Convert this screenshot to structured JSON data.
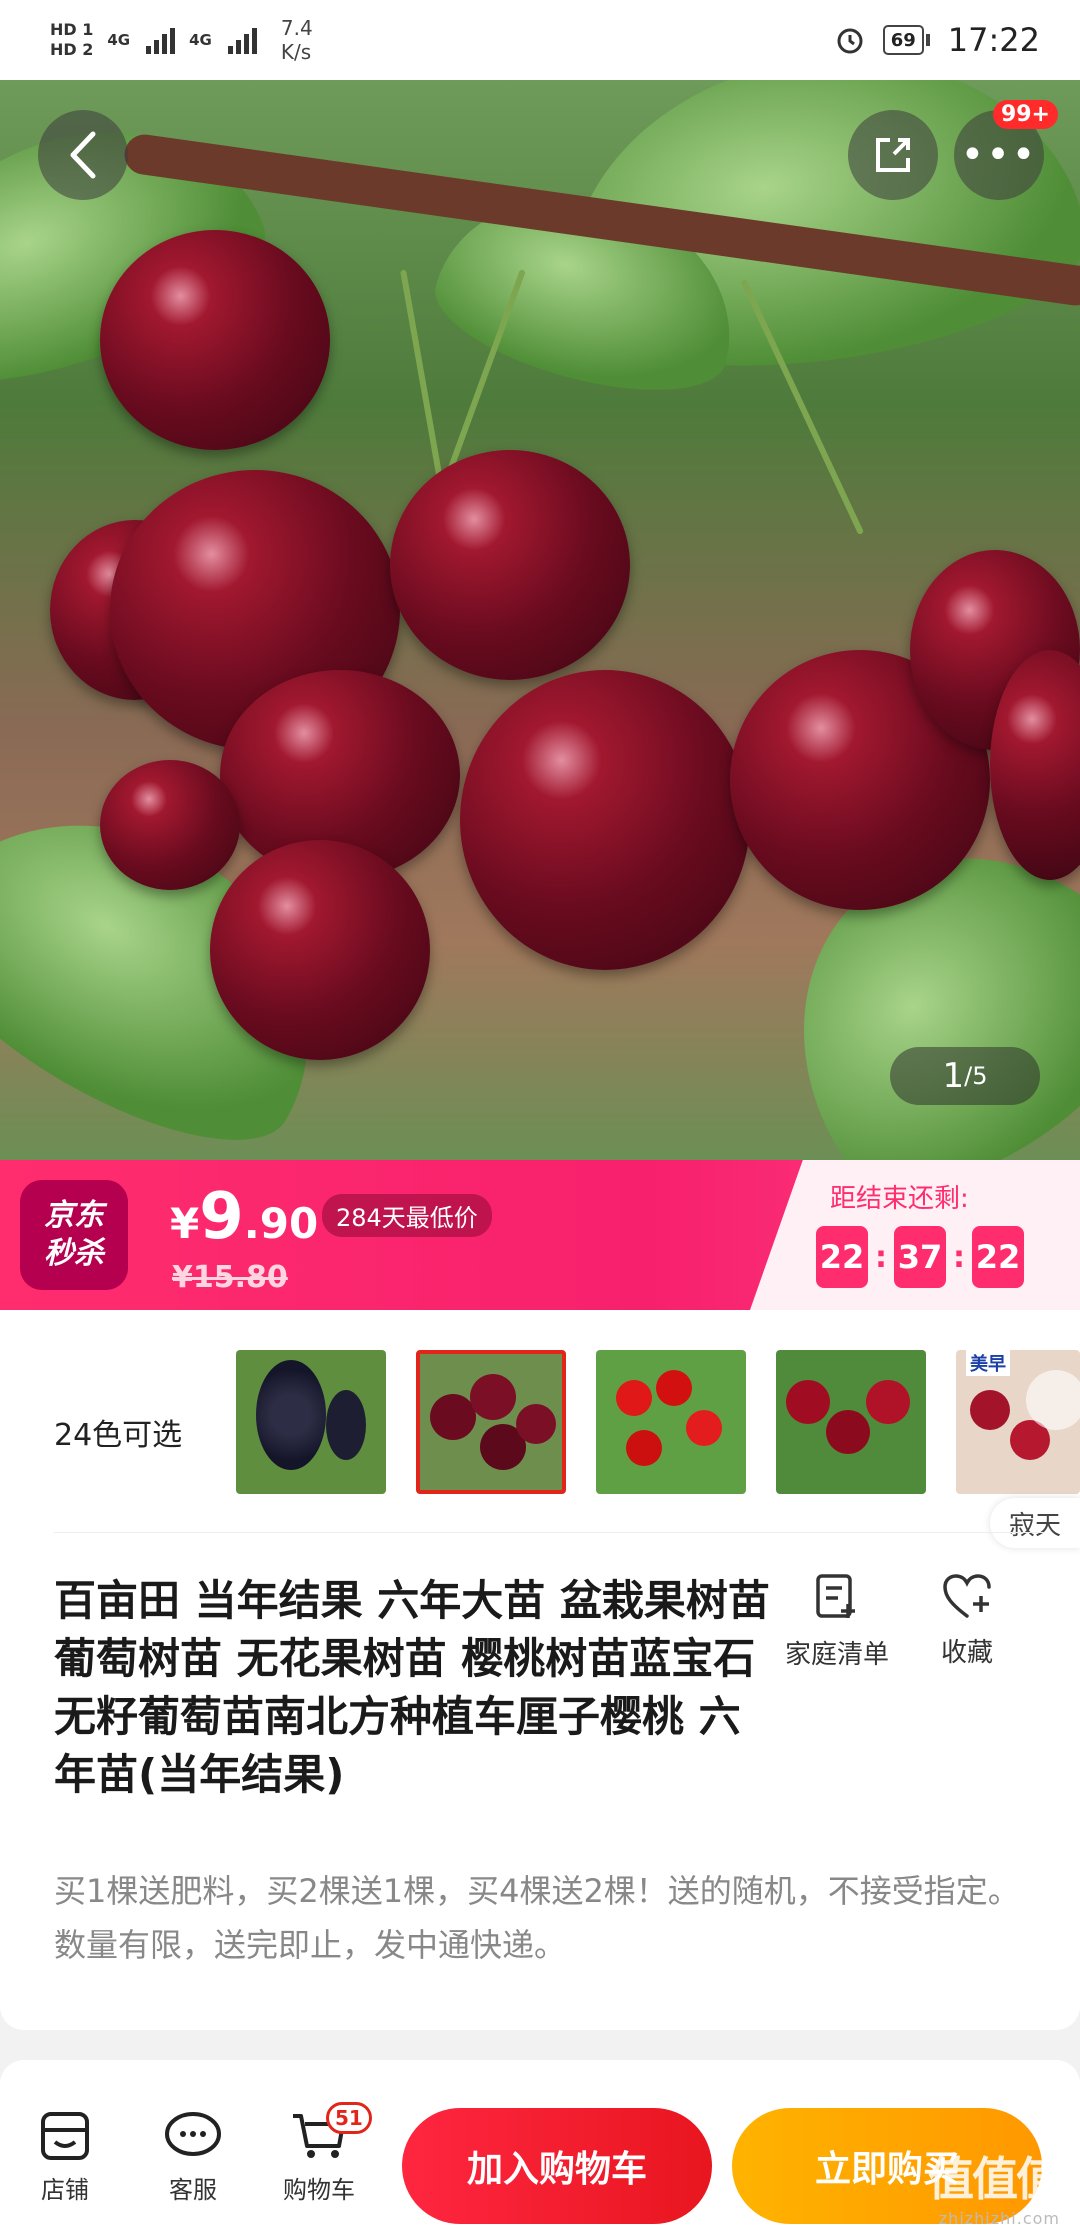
{
  "status_bar": {
    "sim1": "HD 1",
    "sim2": "HD 2",
    "net1": "4G",
    "net2": "4G",
    "speed": "7.4\nK/s",
    "battery": "69",
    "time": "17:22"
  },
  "hero": {
    "more_badge": "99+",
    "pager_current": "1",
    "pager_total": "/5"
  },
  "flash_sale": {
    "logo_line1": "京东",
    "logo_line2": "秒杀",
    "price_symbol": "¥",
    "price_int": "9",
    "price_dec": ".90",
    "lowest_tag": "284天最低价",
    "original_price": "¥15.80",
    "countdown_label": "距结束还剩:",
    "hours": "22",
    "minutes": "37",
    "seconds": "22",
    "colors": {
      "primary": "#ff2d6e",
      "light_bg": "#fff0f5"
    }
  },
  "variants": {
    "label": "24色可选",
    "thumb5_label": "美早",
    "side_tag": "寂天"
  },
  "product": {
    "title": "百亩田 当年结果 六年大苗 盆栽果树苗 葡萄树苗 无花果树苗 樱桃树苗蓝宝石无籽葡萄苗南北方种植车厘子樱桃 六年苗(当年结果)",
    "family_list_label": "家庭清单",
    "favorite_label": "收藏",
    "promo": "买1棵送肥料，买2棵送1棵，买4棵送2棵！送的随机，不接受指定。数量有限，送完即止，发中通快递。"
  },
  "bottom_bar": {
    "shop_label": "店铺",
    "service_label": "客服",
    "cart_label": "购物车",
    "cart_count": "51",
    "add_to_cart": "加入购物车",
    "buy_now": "立即购买",
    "colors": {
      "cart_red": "#e8161f",
      "buy_orange": "#ff9800"
    }
  },
  "watermark": {
    "text": "值值值",
    "domain": "zhizhizhi.com"
  }
}
